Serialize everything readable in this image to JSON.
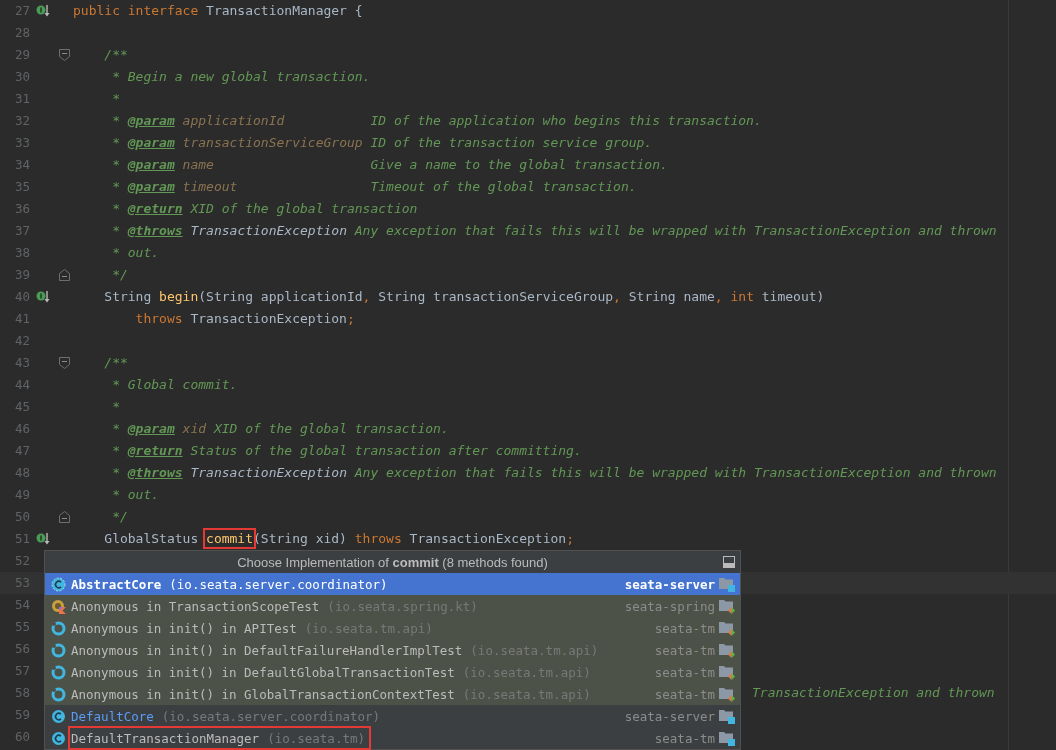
{
  "editor": {
    "lines": [
      {
        "number": "27",
        "marker": true,
        "tokens": [
          {
            "kind": "kw",
            "text": "public interface "
          },
          {
            "kind": "plain",
            "text": "TransactionManager {"
          }
        ]
      },
      {
        "number": "28"
      },
      {
        "number": "29",
        "kind": "fold-start",
        "tokens": [
          {
            "kind": "doc",
            "text": "    /**"
          }
        ]
      },
      {
        "number": "30",
        "tokens": [
          {
            "kind": "doc",
            "text": "     * Begin a new global transaction."
          }
        ]
      },
      {
        "number": "31",
        "tokens": [
          {
            "kind": "doc",
            "text": "     *"
          }
        ]
      },
      {
        "number": "32",
        "tokens": [
          {
            "kind": "doc",
            "text": "     * "
          },
          {
            "kind": "tag",
            "text": "@param"
          },
          {
            "kind": "param",
            "text": " applicationId"
          },
          {
            "kind": "doc",
            "text": "           ID of the application who begins this transaction."
          }
        ]
      },
      {
        "number": "33",
        "tokens": [
          {
            "kind": "doc",
            "text": "     * "
          },
          {
            "kind": "tag",
            "text": "@param"
          },
          {
            "kind": "param",
            "text": " transactionServiceGroup"
          },
          {
            "kind": "doc",
            "text": " ID of the transaction service group."
          }
        ]
      },
      {
        "number": "34",
        "tokens": [
          {
            "kind": "doc",
            "text": "     * "
          },
          {
            "kind": "tag",
            "text": "@param"
          },
          {
            "kind": "param",
            "text": " name"
          },
          {
            "kind": "doc",
            "text": "                    Give a name to the global transaction."
          }
        ]
      },
      {
        "number": "35",
        "tokens": [
          {
            "kind": "doc",
            "text": "     * "
          },
          {
            "kind": "tag",
            "text": "@param"
          },
          {
            "kind": "param",
            "text": " timeout"
          },
          {
            "kind": "doc",
            "text": "                 Timeout of the global transaction."
          }
        ]
      },
      {
        "number": "36",
        "tokens": [
          {
            "kind": "doc",
            "text": "     * "
          },
          {
            "kind": "tag",
            "text": "@return"
          },
          {
            "kind": "doc",
            "text": " XID of the global transaction"
          }
        ]
      },
      {
        "number": "37",
        "tokens": [
          {
            "kind": "doc",
            "text": "     * "
          },
          {
            "kind": "tag",
            "text": "@throws"
          },
          {
            "kind": "ref",
            "text": " TransactionException"
          },
          {
            "kind": "doc",
            "text": " Any exception that fails this will be wrapped with TransactionException and thrown"
          }
        ]
      },
      {
        "number": "38",
        "tokens": [
          {
            "kind": "doc",
            "text": "     * out."
          }
        ]
      },
      {
        "number": "39",
        "kind": "fold-end",
        "tokens": [
          {
            "kind": "doc",
            "text": "     */"
          }
        ]
      },
      {
        "number": "40",
        "marker": true,
        "tokens": [
          {
            "kind": "plain",
            "text": "    String "
          },
          {
            "kind": "method",
            "text": "begin"
          },
          {
            "kind": "plain",
            "text": "(String applicationId"
          },
          {
            "kind": "kw",
            "text": ", "
          },
          {
            "kind": "plain",
            "text": "String transactionServiceGroup"
          },
          {
            "kind": "kw",
            "text": ", "
          },
          {
            "kind": "plain",
            "text": "String name"
          },
          {
            "kind": "kw",
            "text": ", int"
          },
          {
            "kind": "plain",
            "text": " timeout)"
          }
        ]
      },
      {
        "number": "41",
        "tokens": [
          {
            "kind": "kw",
            "text": "        throws"
          },
          {
            "kind": "plain",
            "text": " TransactionException"
          },
          {
            "kind": "kw",
            "text": ";"
          }
        ]
      },
      {
        "number": "42"
      },
      {
        "number": "43",
        "kind": "fold-start",
        "tokens": [
          {
            "kind": "doc",
            "text": "    /**"
          }
        ]
      },
      {
        "number": "44",
        "tokens": [
          {
            "kind": "doc",
            "text": "     * Global commit."
          }
        ]
      },
      {
        "number": "45",
        "tokens": [
          {
            "kind": "doc",
            "text": "     *"
          }
        ]
      },
      {
        "number": "46",
        "tokens": [
          {
            "kind": "doc",
            "text": "     * "
          },
          {
            "kind": "tag",
            "text": "@param"
          },
          {
            "kind": "param",
            "text": " xid"
          },
          {
            "kind": "doc",
            "text": " XID of the global transaction."
          }
        ]
      },
      {
        "number": "47",
        "tokens": [
          {
            "kind": "doc",
            "text": "     * "
          },
          {
            "kind": "tag",
            "text": "@return"
          },
          {
            "kind": "doc",
            "text": " Status of the global transaction after committing."
          }
        ]
      },
      {
        "number": "48",
        "tokens": [
          {
            "kind": "doc",
            "text": "     * "
          },
          {
            "kind": "tag",
            "text": "@throws"
          },
          {
            "kind": "ref",
            "text": " TransactionException"
          },
          {
            "kind": "doc",
            "text": " Any exception that fails this will be wrapped with TransactionException and thrown"
          }
        ]
      },
      {
        "number": "49",
        "tokens": [
          {
            "kind": "doc",
            "text": "     * out."
          }
        ]
      },
      {
        "number": "50",
        "kind": "fold-end",
        "tokens": [
          {
            "kind": "doc",
            "text": "     */"
          }
        ]
      },
      {
        "number": "51",
        "marker": true,
        "tokens": [
          {
            "kind": "plain",
            "text": "    GlobalStatus "
          },
          {
            "kind": "method",
            "text": "commit",
            "boxed": true
          },
          {
            "kind": "plain",
            "text": "(String xid) "
          },
          {
            "kind": "kw",
            "text": "throws"
          },
          {
            "kind": "plain",
            "text": " TransactionException"
          },
          {
            "kind": "kw",
            "text": ";"
          }
        ]
      },
      {
        "number": "52"
      },
      {
        "number": "53",
        "current": true
      },
      {
        "number": "54"
      },
      {
        "number": "55"
      },
      {
        "number": "56"
      },
      {
        "number": "57"
      },
      {
        "number": "58",
        "kind": "behind-popup",
        "tokens": [
          {
            "kind": "doc",
            "text": "TransactionException and thrown"
          }
        ]
      },
      {
        "number": "59"
      },
      {
        "number": "60"
      }
    ]
  },
  "popup": {
    "title": "Choose Implementation of **commit** (8 methods found)",
    "items": [
      {
        "kind": "abstract-class",
        "name": "AbstractCore",
        "package": "(io.seata.server.coordinator)",
        "module": "seata-server",
        "test": false,
        "selected": true,
        "boxed": false,
        "color": "#ffffff"
      },
      {
        "kind": "kotlin-anonymous",
        "name": "Anonymous in TransactionScopeTest",
        "package": "(io.seata.spring.kt)",
        "module": "seata-spring",
        "test": true,
        "selected": false,
        "boxed": false,
        "color": "#bbbbbb"
      },
      {
        "kind": "anonymous",
        "name": "Anonymous in init() in APITest",
        "package": "(io.seata.tm.api)",
        "module": "seata-tm",
        "test": true,
        "selected": false,
        "boxed": false,
        "color": "#bbbbbb"
      },
      {
        "kind": "anonymous",
        "name": "Anonymous in init() in DefaultFailureHandlerImplTest",
        "package": "(io.seata.tm.api)",
        "module": "seata-tm",
        "test": true,
        "selected": false,
        "boxed": false,
        "color": "#bbbbbb"
      },
      {
        "kind": "anonymous",
        "name": "Anonymous in init() in DefaultGlobalTransactionTest",
        "package": "(io.seata.tm.api)",
        "module": "seata-tm",
        "test": true,
        "selected": false,
        "boxed": false,
        "color": "#bbbbbb"
      },
      {
        "kind": "anonymous",
        "name": "Anonymous in init() in GlobalTransactionContextTest",
        "package": "(io.seata.tm.api)",
        "module": "seata-tm",
        "test": true,
        "selected": false,
        "boxed": false,
        "color": "#bbbbbb"
      },
      {
        "kind": "class",
        "name": "DefaultCore",
        "package": "(io.seata.server.coordinator)",
        "module": "seata-server",
        "test": false,
        "selected": false,
        "boxed": false,
        "color": "#589df6"
      },
      {
        "kind": "class",
        "name": "DefaultTransactionManager",
        "package": "(io.seata.tm)",
        "module": "seata-tm",
        "test": false,
        "selected": false,
        "boxed": true,
        "color": "#bbbbbb"
      }
    ]
  }
}
